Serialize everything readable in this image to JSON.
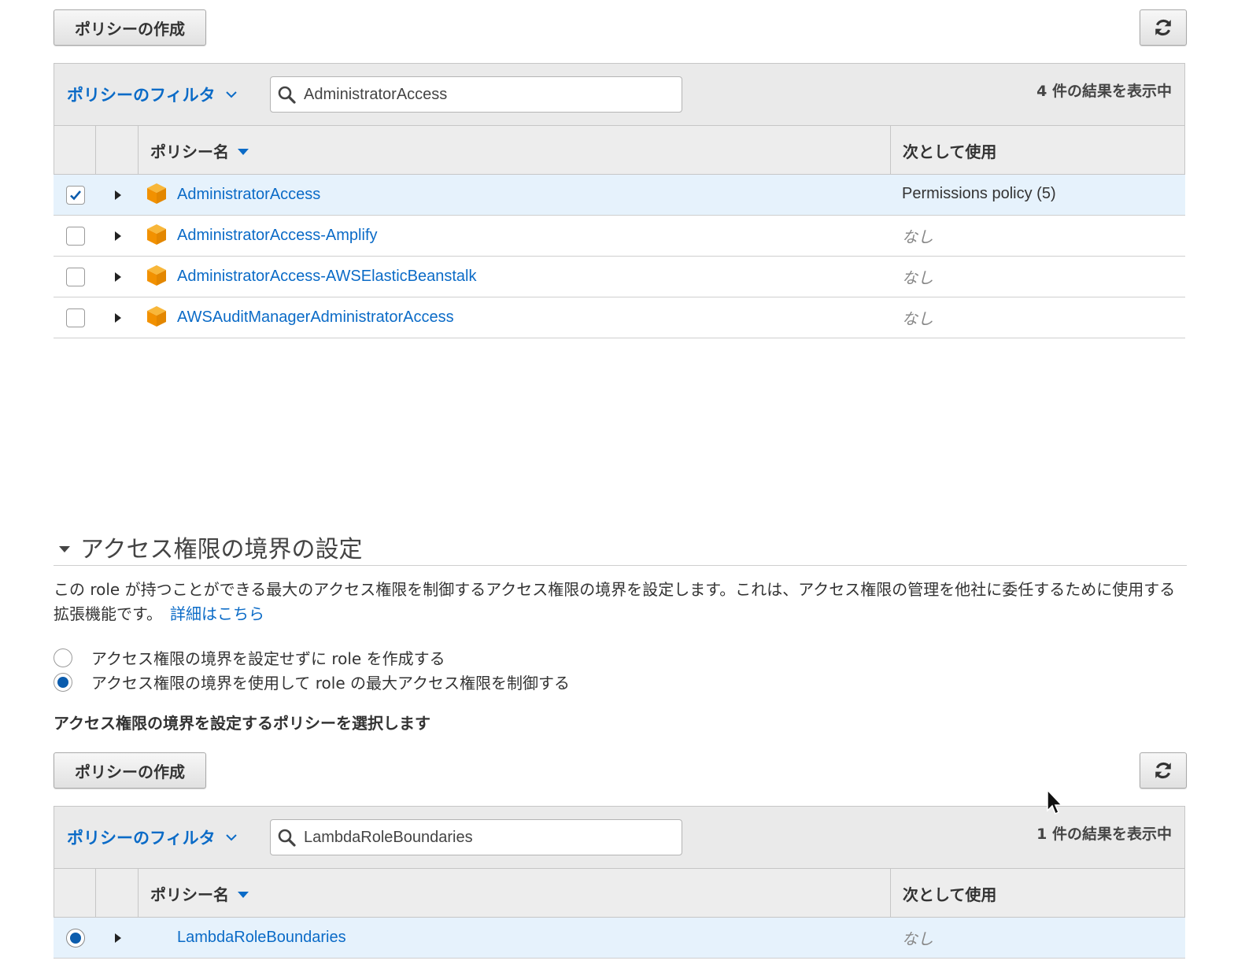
{
  "permissions": {
    "create_button": "ポリシーの作成",
    "filter_label": "ポリシーのフィルタ",
    "search_value": "AdministratorAccess",
    "result_count": "4 件の結果を表示中",
    "columns": {
      "name": "ポリシー名",
      "used_as": "次として使用"
    },
    "rows": [
      {
        "name": "AdministratorAccess",
        "used_as": "Permissions policy (5)",
        "checked": true
      },
      {
        "name": "AdministratorAccess-Amplify",
        "used_as": "なし",
        "checked": false
      },
      {
        "name": "AdministratorAccess-AWSElasticBeanstalk",
        "used_as": "なし",
        "checked": false
      },
      {
        "name": "AWSAuditManagerAdministratorAccess",
        "used_as": "なし",
        "checked": false
      }
    ]
  },
  "boundary": {
    "title": "アクセス権限の境界の設定",
    "description": "この role が持つことができる最大のアクセス権限を制御するアクセス権限の境界を設定します。これは、アクセス権限の管理を他社に委任するために使用する拡張機能です。",
    "learn_more": "詳細はこちら",
    "options": [
      {
        "label": "アクセス権限の境界を設定せずに role を作成する",
        "selected": false
      },
      {
        "label": "アクセス権限の境界を使用して role の最大アクセス権限を制御する",
        "selected": true
      }
    ],
    "choose_label": "アクセス権限の境界を設定するポリシーを選択します",
    "create_button": "ポリシーの作成",
    "filter_label": "ポリシーのフィルタ",
    "search_value": "LambdaRoleBoundaries",
    "result_count": "1 件の結果を表示中",
    "columns": {
      "name": "ポリシー名",
      "used_as": "次として使用"
    },
    "rows": [
      {
        "name": "LambdaRoleBoundaries",
        "used_as": "なし",
        "selected": true
      }
    ]
  },
  "colors": {
    "link": "#0b6bc7",
    "selected_row": "#e6f2fc",
    "header_bg": "#eaeaea",
    "aws_orange": "#f29100",
    "radio_selected": "#0b5cad"
  },
  "icons": [
    "refresh-icon",
    "search-icon",
    "chevron-down-icon",
    "sort-desc-icon",
    "expand-arrow-icon",
    "aws-managed-policy-icon",
    "checkmark-icon",
    "mouse-cursor-icon"
  ]
}
